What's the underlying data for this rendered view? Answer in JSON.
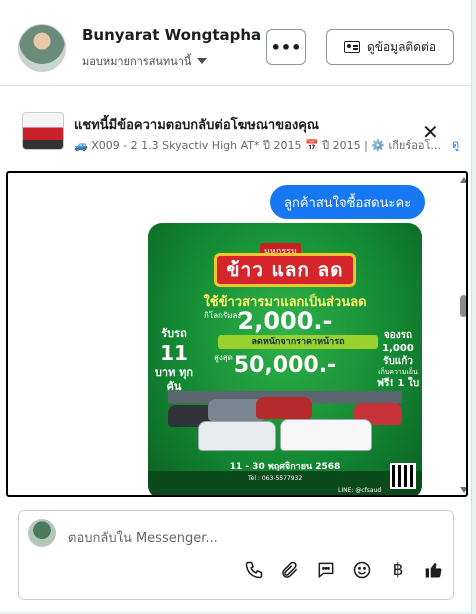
{
  "header": {
    "contact_name": "Bunyarat Wongtapha",
    "assign_label": "มอบหมายการสนทนานี้",
    "more_label": "•••",
    "contact_info_label": "ดูข้อมูลติดต่อ"
  },
  "ad_bar": {
    "title": "แชทนี้มีข้อความตอบกลับต่อโฆษณาของคุณ",
    "subtitle": "🚙 X009 - 2 1.3 Skyactiv High AT* ปี 2015 📅 ปี 2015 | ⚙️ เกียร์ออโ...",
    "details_link": "ดู"
  },
  "chat": {
    "messages": [
      {
        "text": "ลูกค้าสนใจซื้อสดนะคะ",
        "from": "customer"
      }
    ],
    "poster": {
      "top_badge": "มหกรรม",
      "headline": "ข้าว แลก ลด",
      "line1": "ใช้ข้าวสารมาแลกเป็นส่วนลด",
      "small1": "กิโลกรัมละ",
      "amount1": "2,000.-",
      "bar_text": "ลดหนักจากราคาหน้ารถ",
      "small2": "สูงสุด",
      "amount2": "50,000.-",
      "left_top": "รับรถ",
      "left_big": "11",
      "left_bottom": "บาท ทุกคัน",
      "right_top": "จองรถ",
      "right_big": "1,000",
      "right_mid": "รับแก้ว",
      "right_small": "เก็บความเย็น",
      "right_bottom": "ฟรี! 1 ใบ",
      "date": "11 - 30 พฤศจิกายน 2568",
      "footer_tel": "Tel : 063-5577932",
      "footer_line": "LINE: @cfsaud"
    }
  },
  "composer": {
    "placeholder": "ตอบกลับใน Messenger...",
    "tools": [
      "phone-icon",
      "attach-icon",
      "quick-reply-icon",
      "emoji-icon",
      "baht-icon",
      "thumbs-up-icon"
    ],
    "baht_symbol": "฿"
  },
  "colors": {
    "accent": "#1877f2",
    "poster_green": "#138a33",
    "headline_red": "#d6262b"
  }
}
